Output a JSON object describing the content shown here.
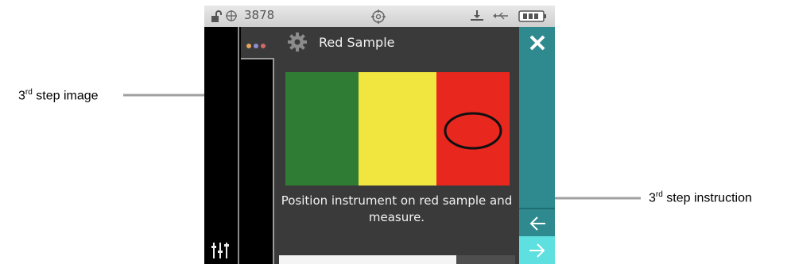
{
  "callouts": {
    "image": {
      "ordinal": "3",
      "suffix": "rd",
      "rest": " step image"
    },
    "instruction": {
      "ordinal": "3",
      "suffix": "rd",
      "rest": " step instruction"
    }
  },
  "status_bar": {
    "counter": "3878",
    "icons": [
      "lock-open-icon",
      "crosshair-icon",
      "target-icon",
      "download-icon",
      "usb-icon",
      "battery-icon"
    ]
  },
  "header": {
    "title": "Red Sample",
    "icons": [
      "dots-menu-icon",
      "gear-icon"
    ]
  },
  "step": {
    "image": {
      "description_icon": "color-sample-image",
      "stripes": [
        "#2f7d34",
        "#f1e640",
        "#e8271f"
      ]
    },
    "instruction": "Position instrument on red sample and measure."
  },
  "progress": {
    "fraction": 0.75
  },
  "right_rail": {
    "buttons": [
      "close-icon",
      "back-arrow-icon",
      "next-arrow-icon"
    ]
  },
  "left_rail": {
    "bottom_icon": "sliders-icon"
  },
  "colors": {
    "accent": "#2f8a8f",
    "next_highlight": "#5fe0e0",
    "background": "#3a3a3a"
  }
}
